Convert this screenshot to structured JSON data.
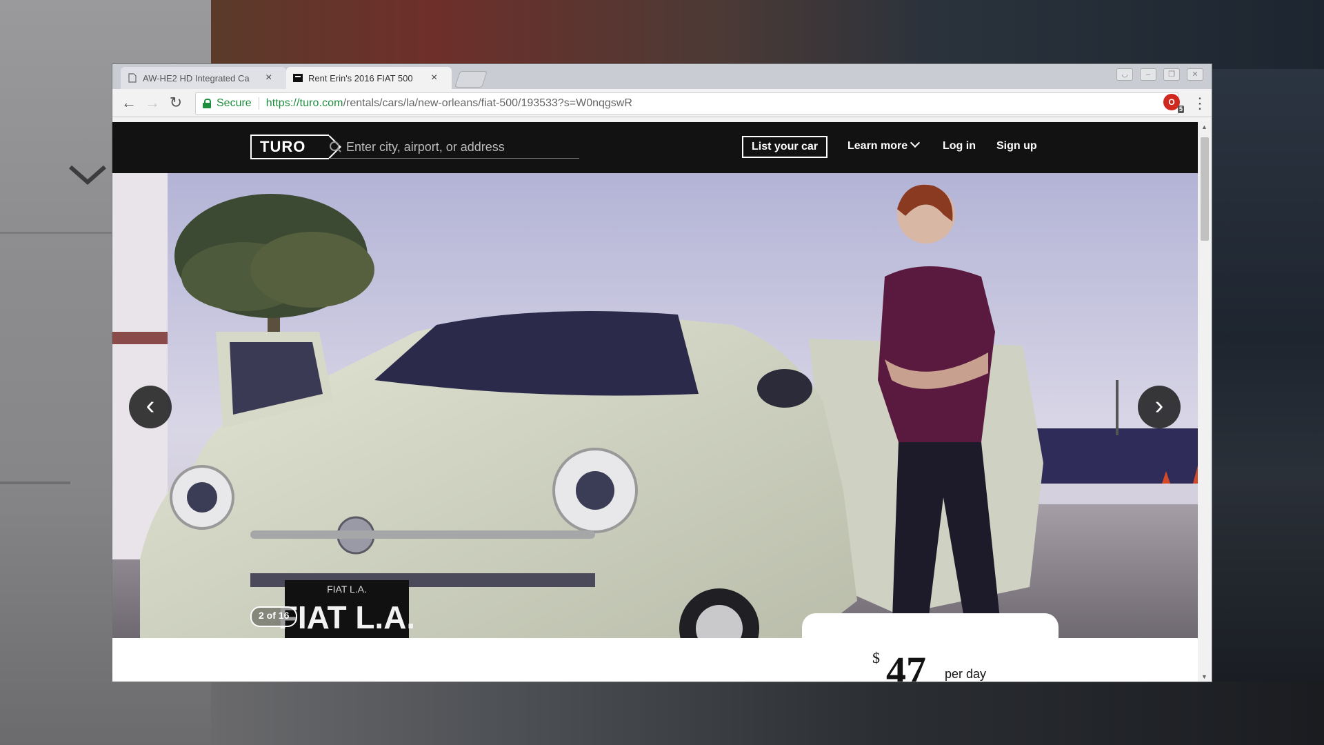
{
  "browser": {
    "tabs": [
      {
        "title": "AW-HE2 HD Integrated Ca",
        "active": false
      },
      {
        "title": "Rent Erin's 2016 FIAT 500",
        "active": true
      }
    ],
    "secure_label": "Secure",
    "url_host": "https://turo.com",
    "url_path": "/rentals/cars/la/new-orleans/fiat-500/193533?s=W0nqgswR",
    "extension_badge": "5"
  },
  "site": {
    "logo": "TURO",
    "search_placeholder": "Enter city, airport, or address",
    "nav": {
      "list_car": "List your car",
      "learn_more": "Learn more",
      "log_in": "Log in",
      "sign_up": "Sign up"
    }
  },
  "hero": {
    "photo_counter": "2 of 16",
    "plate_top": "FIAT L.A.",
    "plate_main": "FIAT L.A."
  },
  "pricing": {
    "currency": "$",
    "price": "47",
    "unit": "per day"
  },
  "colors": {
    "header_bg": "#121212",
    "secure_green": "#1e8e3e"
  }
}
